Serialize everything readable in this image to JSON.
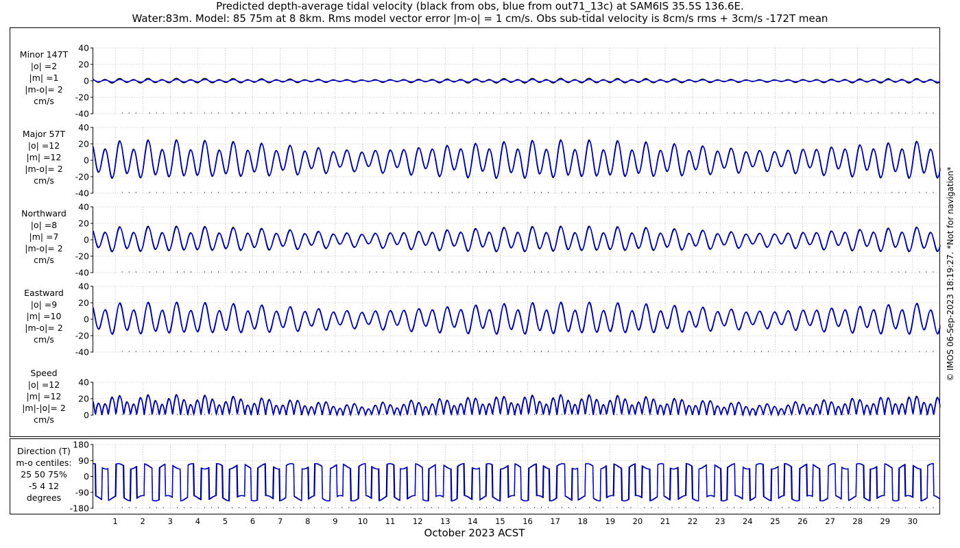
{
  "title": {
    "line1": "Predicted depth-average tidal velocity (black from obs, blue from out71_13c) at SAM6IS 35.5S 136.6E.",
    "line2": "Water:83m. Model: 85 75m at 8 8km. Rms model vector error |m-o| = 1 cm/s. Obs sub-tidal velocity is 8cm/s rms + 3cm/s -172T mean"
  },
  "copyright": "© IMOS 06-Sep-2023 18:19:27. *Not for navigation*",
  "colors": {
    "obs": "#000000",
    "model": "#0000cc",
    "grid": "#aaaaaa"
  },
  "chart_data": {
    "type": "line",
    "xlabel": "October 2023 ACST",
    "x_ticks": [
      "1",
      "2",
      "3",
      "4",
      "5",
      "6",
      "7",
      "8",
      "9",
      "10",
      "11",
      "12",
      "13",
      "14",
      "15",
      "16",
      "17",
      "18",
      "19",
      "20",
      "21",
      "22",
      "23",
      "24",
      "25",
      "26",
      "27",
      "28",
      "29",
      "30"
    ],
    "x_range_days": [
      0.2,
      31.0
    ],
    "grid": true,
    "series": [
      {
        "name": "obs",
        "color": "#000000"
      },
      {
        "name": "out71_13c",
        "color": "#0000cc"
      }
    ],
    "panels": [
      {
        "id": "minor",
        "label": [
          "Minor 147T",
          "|o| =2",
          "|m| =1",
          "|m-o|= 2",
          "cm/s"
        ],
        "ylim": [
          -40,
          40
        ],
        "yticks": [
          "40",
          "20",
          "0",
          "-20",
          "-40"
        ],
        "amp_obs": 3,
        "amp_model": 1.6,
        "kind": "signed"
      },
      {
        "id": "major",
        "label": [
          "Major 57T",
          "|o| =12",
          "|m| =12",
          "|m-o|= 2",
          "cm/s"
        ],
        "ylim": [
          -40,
          40
        ],
        "yticks": [
          "40",
          "20",
          "0",
          "-20",
          "-40"
        ],
        "amp_obs": 24,
        "amp_model": 23,
        "kind": "signed"
      },
      {
        "id": "north",
        "label": [
          "Northward",
          "|o| =8",
          "|m| =7",
          "|m-o|= 2",
          "cm/s"
        ],
        "ylim": [
          -40,
          40
        ],
        "yticks": [
          "40",
          "20",
          "0",
          "-20",
          "-40"
        ],
        "amp_obs": 16,
        "amp_model": 15,
        "kind": "signed"
      },
      {
        "id": "east",
        "label": [
          "Eastward",
          "|o| =9",
          "|m| =10",
          "|m-o|= 2",
          "cm/s"
        ],
        "ylim": [
          -40,
          40
        ],
        "yticks": [
          "40",
          "20",
          "0",
          "-20",
          "-40"
        ],
        "amp_obs": 19,
        "amp_model": 20,
        "kind": "signed"
      },
      {
        "id": "speed",
        "label": [
          "Speed",
          "|o| =12",
          "|m| =12",
          "|m|-|o|= 2",
          "cm/s"
        ],
        "ylim": [
          0,
          40
        ],
        "yticks": [
          "40",
          "20",
          "0"
        ],
        "amp_obs": 24,
        "amp_model": 23,
        "kind": "speed"
      },
      {
        "id": "direction",
        "label": [
          "Direction (T)",
          "m-o centiles:",
          "25  50  75%",
          "-5   4  12",
          "degrees"
        ],
        "ylim": [
          -180,
          180
        ],
        "yticks": [
          "180",
          "90",
          "0",
          "-90",
          "-180"
        ],
        "kind": "direction"
      }
    ]
  }
}
